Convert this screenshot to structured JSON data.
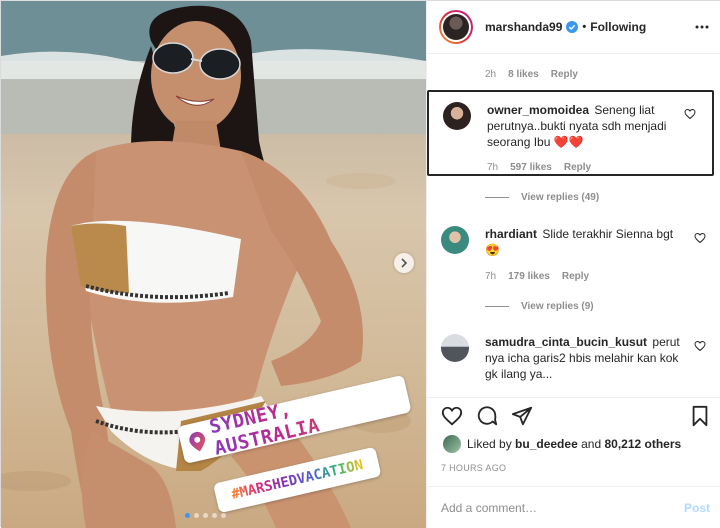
{
  "post": {
    "location_sticker": "SYDNEY, AUSTRALIA",
    "hashtag_sticker": "#MARSHEDVACATION",
    "carousel_slides": 5,
    "active_slide": 1
  },
  "header": {
    "username": "marshanda99",
    "separator": "•",
    "follow_label": "Following"
  },
  "top_meta": {
    "time": "2h",
    "likes": "8 likes",
    "reply": "Reply"
  },
  "comments": [
    {
      "username": "owner_momoidea",
      "text": "Seneng liat perutnya..bukti nyata sdh menjadi seorang Ibu ❤️❤️",
      "time": "7h",
      "likes": "597 likes",
      "reply": "Reply",
      "view_replies": "View replies (49)"
    },
    {
      "username": "rhardiant",
      "text": "Slide terakhir Sienna bgt😍",
      "time": "7h",
      "likes": "179 likes",
      "reply": "Reply",
      "view_replies": "View replies (9)"
    },
    {
      "username": "samudra_cinta_bucin_kusut",
      "text": "perut nya icha garis2 hbis melahir kan kok gk ilang ya..."
    }
  ],
  "liked_by": {
    "prefix": "Liked by",
    "user": "bu_deedee",
    "middle": "and",
    "others": "80,212 others"
  },
  "timestamp": "7 HOURS AGO",
  "add_comment": {
    "placeholder": "Add a comment…",
    "post_label": "Post"
  },
  "colors": {
    "accent": "#3897f0",
    "post_disabled": "#b3dbff",
    "muted": "#8e8e8e",
    "text": "#262626"
  },
  "icons": [
    "heart-icon",
    "comment-icon",
    "share-icon",
    "bookmark-icon",
    "more-icon",
    "verified-icon",
    "location-pin-icon",
    "chevron-right-icon"
  ]
}
